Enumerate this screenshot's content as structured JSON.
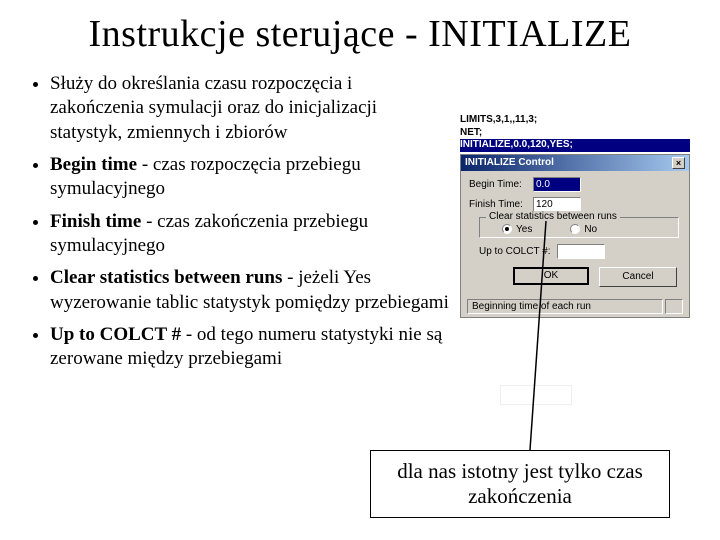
{
  "title": "Instrukcje sterujące - INITIALIZE",
  "bullets": [
    {
      "text": "Służy do określania czasu rozpoczęcia i zakończenia symulacji oraz do inicjalizacji statystyk, zmiennych i zbiorów"
    },
    {
      "lead": "Begin time",
      "rest": " - czas rozpoczęcia przebiegu symulacyjnego"
    },
    {
      "lead": "Finish time",
      "rest": " - czas zakończenia przebiegu symulacyjnego"
    },
    {
      "lead": "Clear statistics between runs",
      "rest": " - jeżeli Yes wyzerowanie tablic statystyk pomiędzy przebiegami"
    },
    {
      "lead": "Up to COLCT #",
      "rest": " - od tego numeru statystyki nie są zerowane między przebiegami"
    }
  ],
  "code": {
    "l1": "LIMITS,3,1,,11,3;",
    "l2": "NET;",
    "l3": "INITIALIZE,0.0,120,YES;"
  },
  "dialog": {
    "title": "INITIALIZE Control",
    "begin_label": "Begin Time:",
    "begin_value": "0.0",
    "finish_label": "Finish Time:",
    "finish_value": "120",
    "group_title": "Clear statistics between runs",
    "radio_yes": "Yes",
    "radio_no": "No",
    "upto_label": "Up to COLCT #:",
    "upto_value": "",
    "ok": "OK",
    "cancel": "Cancel",
    "status": "Beginning time of each run"
  },
  "callout": "dla nas istotny jest tylko czas zakończenia"
}
